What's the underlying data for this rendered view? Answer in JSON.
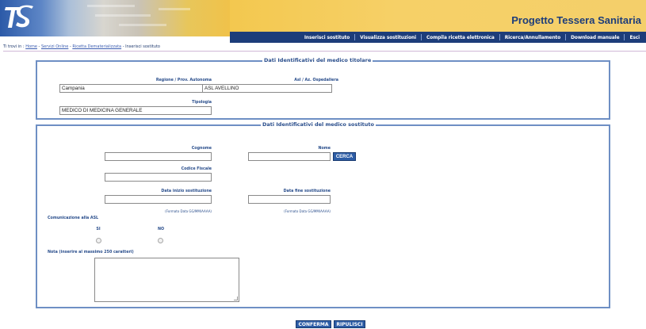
{
  "header": {
    "logo_text": "TS",
    "app_title": "Progetto Tessera Sanitaria",
    "nav": [
      "Inserisci sostituto",
      "Visualizza sostituzioni",
      "Compila ricetta elettronica",
      "Ricerca/Annullamento",
      "Download manuale",
      "Esci"
    ]
  },
  "breadcrumb": {
    "prefix": "Ti trovi in : ",
    "items": [
      "Home",
      "Servizi Online",
      "Ricetta Dematerializzata",
      "Inserisci sostituto"
    ],
    "separator": " - "
  },
  "titolare": {
    "legend": "Dati Identificativi del medico titolare",
    "regione_label": "Regione / Prov. Autonoma",
    "regione_value": "Campania",
    "asl_label": "Asl / Az. Ospedaliera",
    "asl_value": "ASL AVELLINO",
    "tipologia_label": "Tipologia",
    "tipologia_value": "MEDICO DI MEDICINA GENERALE"
  },
  "sostituto": {
    "legend": "Dati Identificativi del medico sostituto",
    "cognome_label": "Cognome",
    "cognome_value": "",
    "nome_label": "Nome",
    "nome_value": "",
    "cerca_label": "CERCA",
    "codice_fiscale_label": "Codice Fiscale",
    "codice_fiscale_value": "",
    "data_inizio_label": "Data inizio sostituzione",
    "data_inizio_value": "",
    "data_inizio_hint": "(Formato Data GG/MM/AAAA)",
    "data_fine_label": "Data fine sostituzione",
    "data_fine_value": "",
    "data_fine_hint": "(Formato Data GG/MM/AAAA)",
    "comunicazione_label": "Comunicazione alla ASL",
    "si_label": "SI",
    "no_label": "NO",
    "nota_label": "Nota (inserire al massimo 250 caratteri)",
    "nota_value": ""
  },
  "actions": {
    "confirm_label": "CONFERMA",
    "reset_label": "RIPULISCI"
  },
  "colors": {
    "brand_navy": "#1d3d7a",
    "header_gold": "#f4cd5c",
    "border_blue": "#6e8fc4",
    "button_blue": "#2d5da6"
  }
}
